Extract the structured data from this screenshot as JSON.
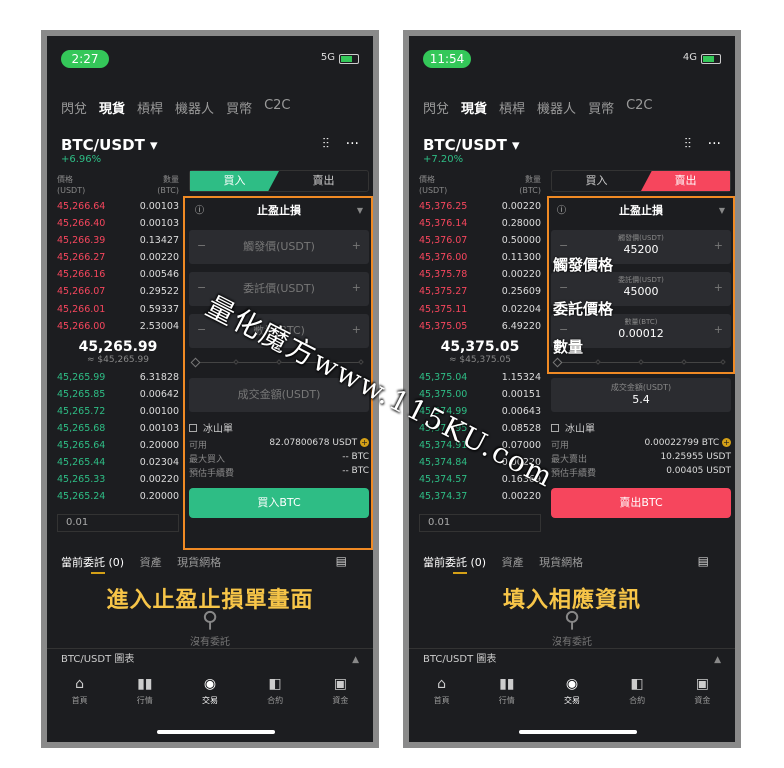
{
  "left": {
    "time": "2:27",
    "network": "5G",
    "tabs": [
      "閃兌",
      "現貨",
      "槓桿",
      "機器人",
      "買幣",
      "C2C"
    ],
    "pair": "BTC/USDT ▾",
    "change": "+6.96%",
    "book_head": {
      "price": "價格\n(USDT)",
      "qty": "數量\n(BTC)"
    },
    "asks": [
      [
        "45,266.64",
        "0.00103"
      ],
      [
        "45,266.40",
        "0.00103"
      ],
      [
        "45,266.39",
        "0.13427"
      ],
      [
        "45,266.27",
        "0.00220"
      ],
      [
        "45,266.16",
        "0.00546"
      ],
      [
        "45,266.07",
        "0.29522"
      ],
      [
        "45,266.01",
        "0.59337"
      ],
      [
        "45,266.00",
        "2.53004"
      ]
    ],
    "last_price": "45,265.99",
    "ref_price": "≈ $45,265.99",
    "bids": [
      [
        "45,265.99",
        "6.31828"
      ],
      [
        "45,265.85",
        "0.00642"
      ],
      [
        "45,265.72",
        "0.00100"
      ],
      [
        "45,265.68",
        "0.00103"
      ],
      [
        "45,265.64",
        "0.20000"
      ],
      [
        "45,265.44",
        "0.02304"
      ],
      [
        "45,265.33",
        "0.00220"
      ],
      [
        "45,265.24",
        "0.20000"
      ]
    ],
    "depth": "0.01",
    "buy_tab": "買入",
    "sell_tab": "賣出",
    "order_type": "止盈止損",
    "trigger_ph": "觸發價(USDT)",
    "limit_ph": "委託價(USDT)",
    "qty_ph": "數量(BTC)",
    "amount_ph": "成交金額(USDT)",
    "iceberg": "冰山單",
    "avail_label": "可用",
    "avail_value": "82.07800678 USDT",
    "max_label": "最大買入",
    "max_value": "-- BTC",
    "fee_label": "預估手續費",
    "fee_value": "-- BTC",
    "action": "買入BTC",
    "caption": "進入止盈止損單畫面"
  },
  "right": {
    "time": "11:54",
    "network": "4G",
    "tabs": [
      "閃兌",
      "現貨",
      "槓桿",
      "機器人",
      "買幣",
      "C2C"
    ],
    "pair": "BTC/USDT ▾",
    "change": "+7.20%",
    "book_head": {
      "price": "價格\n(USDT)",
      "qty": "數量\n(BTC)"
    },
    "asks": [
      [
        "45,376.25",
        "0.00220"
      ],
      [
        "45,376.14",
        "0.28000"
      ],
      [
        "45,376.07",
        "0.50000"
      ],
      [
        "45,376.00",
        "0.11300"
      ],
      [
        "45,375.78",
        "0.00220"
      ],
      [
        "45,375.27",
        "0.25609"
      ],
      [
        "45,375.11",
        "0.02204"
      ],
      [
        "45,375.05",
        "6.49220"
      ]
    ],
    "last_price": "45,375.05",
    "ref_price": "≈ $45,375.05",
    "bids": [
      [
        "45,375.04",
        "1.15324"
      ],
      [
        "45,375.00",
        "0.00151"
      ],
      [
        "45,374.99",
        "0.00643"
      ],
      [
        "45,374.95",
        "0.08528"
      ],
      [
        "45,374.91",
        "0.07000"
      ],
      [
        "45,374.84",
        "0.00220"
      ],
      [
        "45,374.57",
        "0.16369"
      ],
      [
        "45,374.37",
        "0.00220"
      ]
    ],
    "depth": "0.01",
    "buy_tab": "買入",
    "sell_tab": "賣出",
    "order_type": "止盈止損",
    "trigger_label": "觸發價(USDT)",
    "trigger_value": "45200",
    "limit_label": "委託價(USDT)",
    "limit_value": "45000",
    "qty_label": "數量(BTC)",
    "qty_value": "0.00012",
    "amount_label": "成交金額(USDT)",
    "amount_value": "5.4",
    "iceberg": "冰山單",
    "avail_label": "可用",
    "avail_value": "0.00022799 BTC",
    "max_label": "最大賣出",
    "max_value": "10.25955 USDT",
    "fee_label": "預估手續費",
    "fee_value": "0.00405 USDT",
    "action": "賣出BTC",
    "caption": "填入相應資訊",
    "annot_trigger": "觸發價格",
    "annot_limit": "委託價格",
    "annot_qty": "數量"
  },
  "bottom_tabs": [
    "當前委託 (0)",
    "資產",
    "現貨網格"
  ],
  "empty_text": "沒有委託",
  "chart_bar": "BTC/USDT 圖表",
  "nav": [
    "首頁",
    "行情",
    "交易",
    "合約",
    "資金"
  ],
  "watermark": "量化魔方www.115KU.com",
  "colors": {
    "bid": "#2ebd85",
    "ask": "#f6465d",
    "highlight": "#f08a24",
    "caption": "#f7c548"
  }
}
